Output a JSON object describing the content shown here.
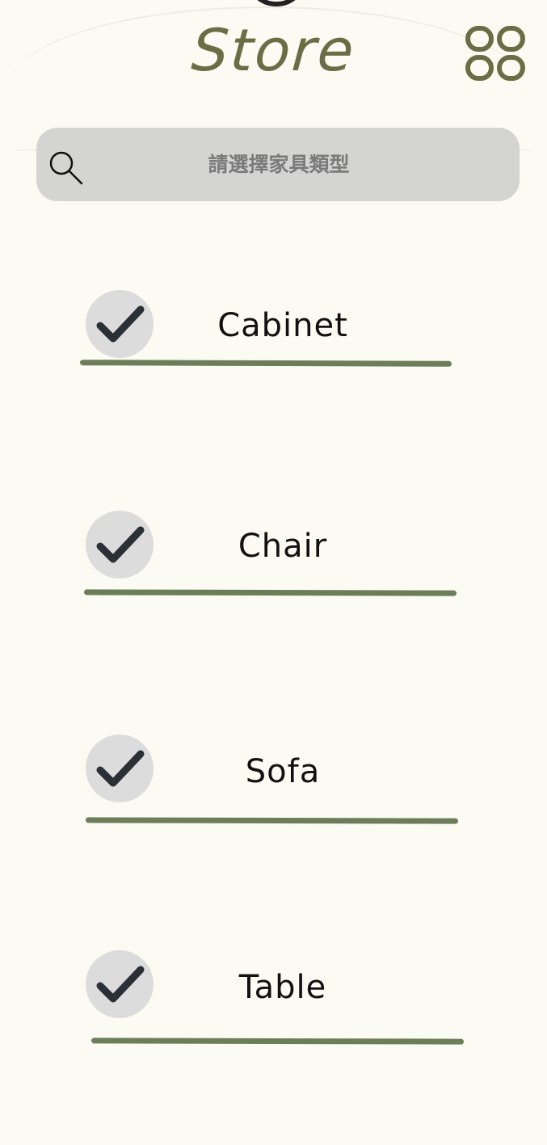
{
  "header": {
    "title": "Store",
    "grid_icon": "grid-icon"
  },
  "search": {
    "placeholder": "請選擇家具類型",
    "icon": "search-icon"
  },
  "categories": [
    {
      "label": "Cabinet",
      "checked": true
    },
    {
      "label": "Chair",
      "checked": true
    },
    {
      "label": "Sofa",
      "checked": true
    },
    {
      "label": "Table",
      "checked": true
    }
  ],
  "colors": {
    "background": "#fbfaf3",
    "title": "#6b6e45",
    "underline": "#6b7d59",
    "check_bg": "#dcdcdc",
    "check_mark": "#2b2f36",
    "search_bg": "#d4d4d2"
  }
}
